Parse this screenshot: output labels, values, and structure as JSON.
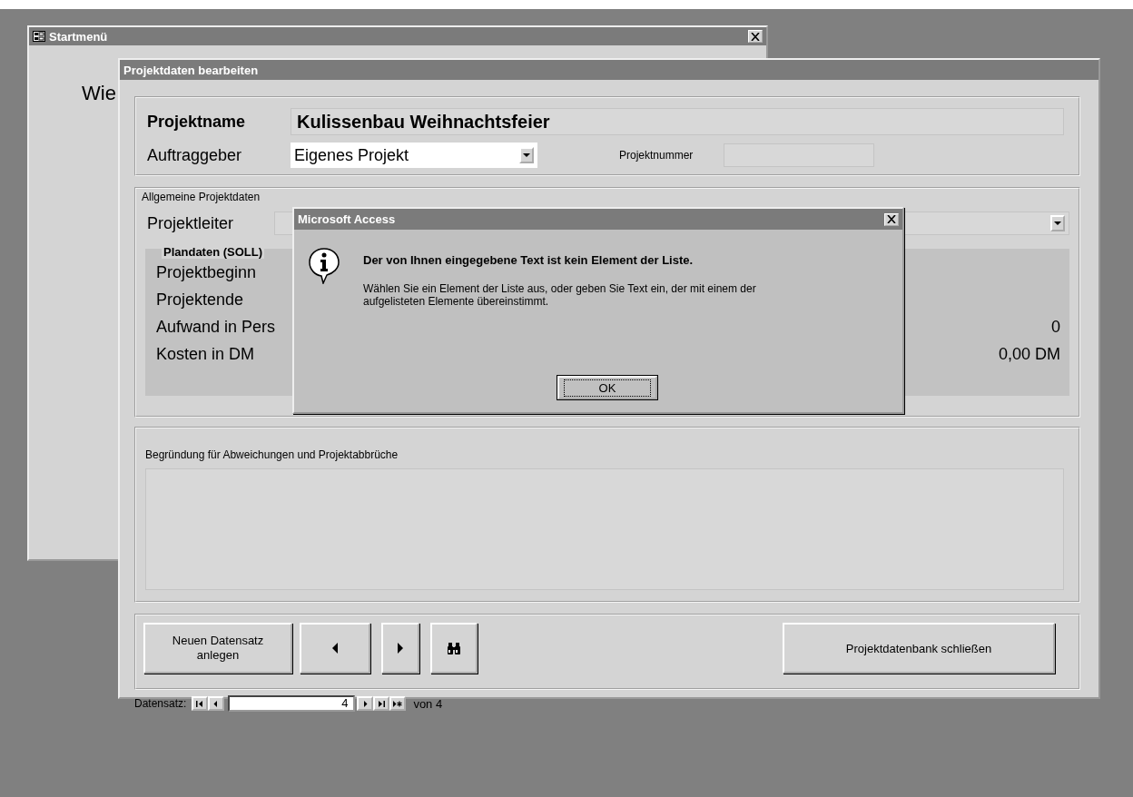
{
  "start_window": {
    "title": "Startmenü",
    "heading": "Wie"
  },
  "form_window": {
    "title": "Projektdaten bearbeiten",
    "header": {
      "name_label": "Projektname",
      "name_value": "Kulissenbau Weihnachtsfeier",
      "client_label": "Auftraggeber",
      "client_value": "Eigenes Projekt",
      "number_label": "Projektnummer"
    },
    "general": {
      "legend": "Allgemeine Projektdaten",
      "leader_label": "Projektleiter",
      "plan": {
        "heading": "Plandaten (SOLL)",
        "rows": [
          {
            "label": "Projektbeginn"
          },
          {
            "label": "Projektende"
          },
          {
            "label": "Aufwand in Pers",
            "value": "0"
          },
          {
            "label": "Kosten in DM",
            "value": "0,00 DM"
          }
        ]
      }
    },
    "reasons": {
      "label": "Begründung für Abweichungen und Projektabbrüche"
    },
    "buttons": [
      {
        "kind": "text",
        "label": "Neuen Datensatz anlegen"
      },
      {
        "kind": "prev"
      },
      {
        "kind": "next"
      },
      {
        "kind": "find"
      }
    ],
    "close_button": "Projektdatenbank schließen",
    "record_nav": {
      "label": "Datensatz:",
      "buttons_before": [
        {
          "kind": "first"
        },
        {
          "kind": "prev"
        }
      ],
      "current": "4",
      "buttons_after": [
        {
          "kind": "next"
        },
        {
          "kind": "last"
        },
        {
          "kind": "new"
        }
      ],
      "total": "von 4"
    }
  },
  "dialog": {
    "title": "Microsoft Access",
    "heading": "Der von Ihnen eingegebene Text ist kein Element der Liste.",
    "message": "Wählen Sie ein Element der Liste aus, oder geben Sie Text ein, der mit einem der aufgelisteten Elemente übereinstimmt.",
    "ok": "OK"
  }
}
